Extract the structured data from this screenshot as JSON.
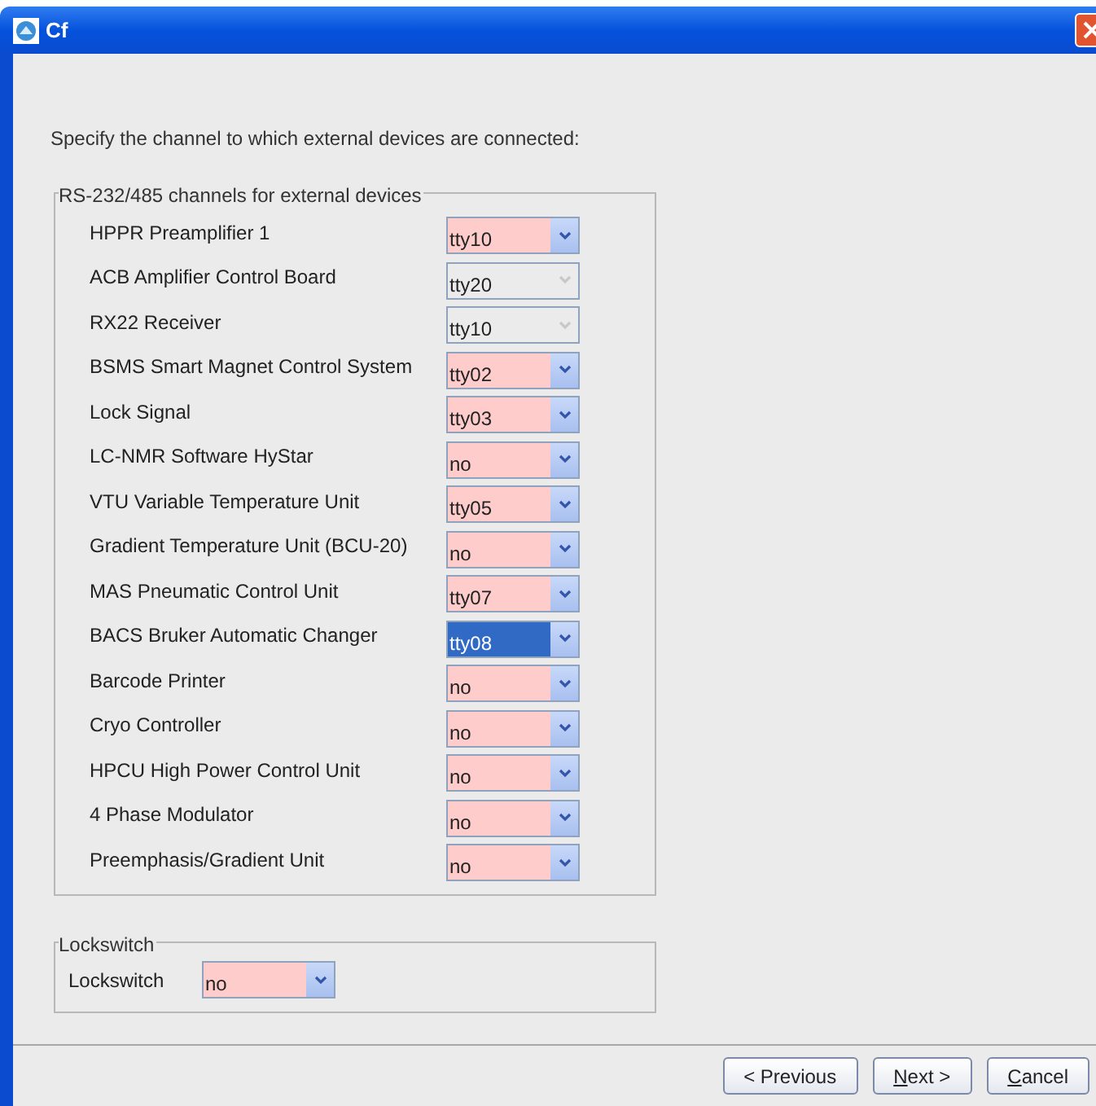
{
  "window": {
    "title": "Cf"
  },
  "instruction": "Specify the channel to which external devices are connected:",
  "channels_group": {
    "title": "RS-232/485 channels for external devices",
    "rows": [
      {
        "label": "HPPR Preamplifier 1",
        "value": "tty10",
        "disabled": false,
        "selected": false
      },
      {
        "label": "ACB Amplifier Control Board",
        "value": "tty20",
        "disabled": true,
        "selected": false
      },
      {
        "label": "RX22 Receiver",
        "value": "tty10",
        "disabled": true,
        "selected": false
      },
      {
        "label": "BSMS Smart Magnet Control System",
        "value": "tty02",
        "disabled": false,
        "selected": false
      },
      {
        "label": "Lock Signal",
        "value": "tty03",
        "disabled": false,
        "selected": false
      },
      {
        "label": "LC-NMR Software HyStar",
        "value": "no",
        "disabled": false,
        "selected": false
      },
      {
        "label": "VTU Variable Temperature Unit",
        "value": "tty05",
        "disabled": false,
        "selected": false
      },
      {
        "label": "Gradient Temperature Unit (BCU-20)",
        "value": "no",
        "disabled": false,
        "selected": false
      },
      {
        "label": "MAS Pneumatic Control Unit",
        "value": "tty07",
        "disabled": false,
        "selected": false
      },
      {
        "label": "BACS Bruker Automatic Changer",
        "value": "tty08",
        "disabled": false,
        "selected": true
      },
      {
        "label": "Barcode Printer",
        "value": "no",
        "disabled": false,
        "selected": false
      },
      {
        "label": "Cryo Controller",
        "value": "no",
        "disabled": false,
        "selected": false
      },
      {
        "label": "HPCU High Power Control Unit",
        "value": "no",
        "disabled": false,
        "selected": false
      },
      {
        "label": "4 Phase Modulator",
        "value": "no",
        "disabled": false,
        "selected": false
      },
      {
        "label": "Preemphasis/Gradient Unit",
        "value": "no",
        "disabled": false,
        "selected": false
      }
    ]
  },
  "lockswitch_group": {
    "title": "Lockswitch",
    "label": "Lockswitch",
    "value": "no"
  },
  "buttons": [
    {
      "parts": [
        {
          "text": "< Previous",
          "underlined": false
        }
      ]
    },
    {
      "parts": [
        {
          "text": "N",
          "underlined": true
        },
        {
          "text": "ext >",
          "underlined": false
        }
      ]
    },
    {
      "parts": [
        {
          "text": "C",
          "underlined": true
        },
        {
          "text": "ancel",
          "underlined": false
        }
      ]
    }
  ]
}
